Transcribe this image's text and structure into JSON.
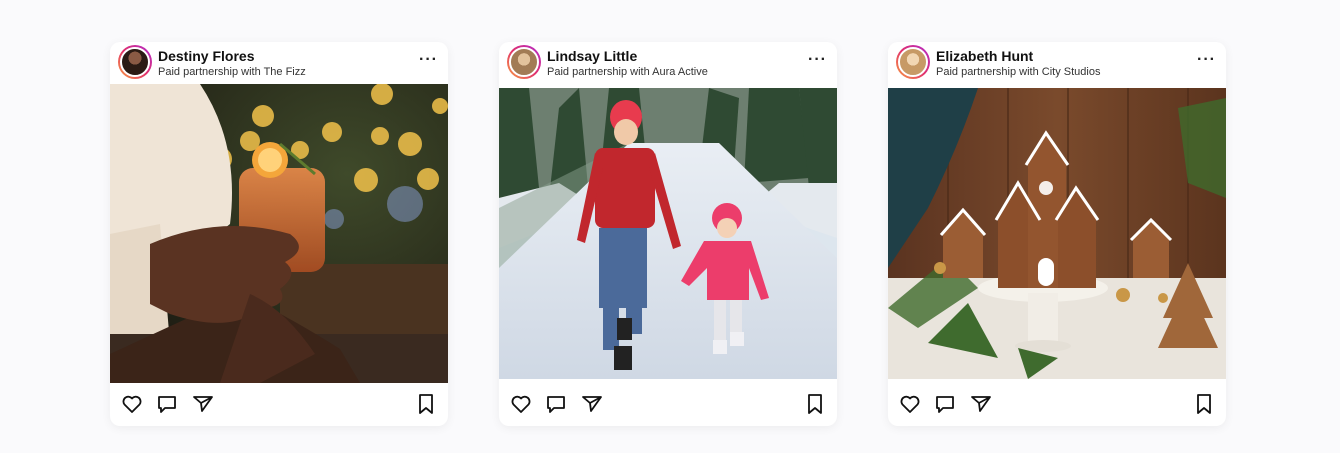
{
  "posts": [
    {
      "username": "Destiny Flores",
      "partnership": "Paid partnership with The Fizz",
      "avatar_color": "#5a3a2c",
      "photo_subject": "hand holding a cocktail glass with orange slice in front of a Christmas tree with bokeh lights"
    },
    {
      "username": "Lindsay Little",
      "partnership": "Paid partnership with Aura Active",
      "avatar_color": "#c9a27a",
      "photo_subject": "mother and child walking on a snowy road through a pine forest"
    },
    {
      "username": "Elizabeth Hunt",
      "partnership": "Paid partnership with City Studios",
      "avatar_color": "#d9b48a",
      "photo_subject": "gingerbread houses on a cake stand with pine branches"
    }
  ],
  "icons": {
    "more": "more-options-icon",
    "like": "heart-icon",
    "comment": "comment-icon",
    "share": "send-icon",
    "save": "bookmark-icon"
  }
}
